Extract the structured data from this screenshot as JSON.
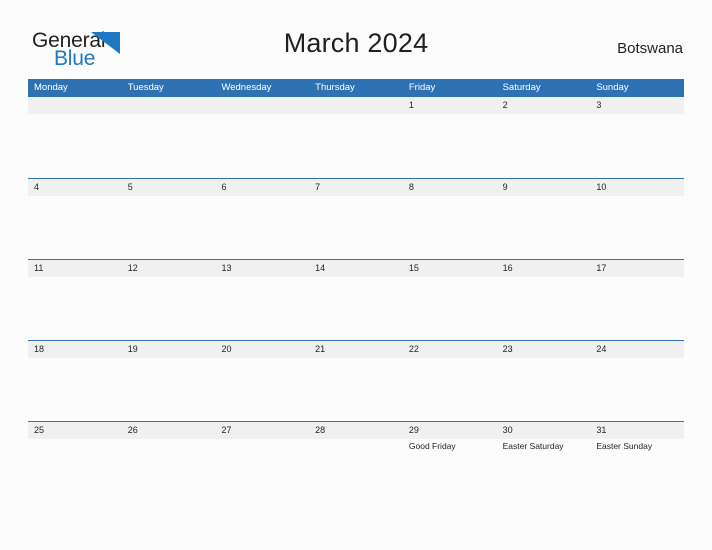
{
  "brand": {
    "name_part1": "General",
    "name_part2": "Blue",
    "triangle_icon": "triangle-icon",
    "dark_color": "#231f20",
    "blue_color": "#1f78c1"
  },
  "header": {
    "title": "March 2024",
    "country": "Botswana"
  },
  "theme": {
    "header_blue": "#2f72b4",
    "band_gray": "#f0f0f0",
    "page_background": "#fcfcfc",
    "text_color": "#231f20"
  },
  "calendar": {
    "month": "March",
    "year": "2024",
    "weekday_headers": [
      "Monday",
      "Tuesday",
      "Wednesday",
      "Thursday",
      "Friday",
      "Saturday",
      "Sunday"
    ],
    "weeks": [
      [
        {
          "num": "",
          "event": ""
        },
        {
          "num": "",
          "event": ""
        },
        {
          "num": "",
          "event": ""
        },
        {
          "num": "",
          "event": ""
        },
        {
          "num": "1",
          "event": ""
        },
        {
          "num": "2",
          "event": ""
        },
        {
          "num": "3",
          "event": ""
        }
      ],
      [
        {
          "num": "4",
          "event": ""
        },
        {
          "num": "5",
          "event": ""
        },
        {
          "num": "6",
          "event": ""
        },
        {
          "num": "7",
          "event": ""
        },
        {
          "num": "8",
          "event": ""
        },
        {
          "num": "9",
          "event": ""
        },
        {
          "num": "10",
          "event": ""
        }
      ],
      [
        {
          "num": "11",
          "event": ""
        },
        {
          "num": "12",
          "event": ""
        },
        {
          "num": "13",
          "event": ""
        },
        {
          "num": "14",
          "event": ""
        },
        {
          "num": "15",
          "event": ""
        },
        {
          "num": "16",
          "event": ""
        },
        {
          "num": "17",
          "event": ""
        }
      ],
      [
        {
          "num": "18",
          "event": ""
        },
        {
          "num": "19",
          "event": ""
        },
        {
          "num": "20",
          "event": ""
        },
        {
          "num": "21",
          "event": ""
        },
        {
          "num": "22",
          "event": ""
        },
        {
          "num": "23",
          "event": ""
        },
        {
          "num": "24",
          "event": ""
        }
      ],
      [
        {
          "num": "25",
          "event": ""
        },
        {
          "num": "26",
          "event": ""
        },
        {
          "num": "27",
          "event": ""
        },
        {
          "num": "28",
          "event": ""
        },
        {
          "num": "29",
          "event": "Good Friday"
        },
        {
          "num": "30",
          "event": "Easter Saturday"
        },
        {
          "num": "31",
          "event": "Easter Sunday"
        }
      ]
    ]
  }
}
